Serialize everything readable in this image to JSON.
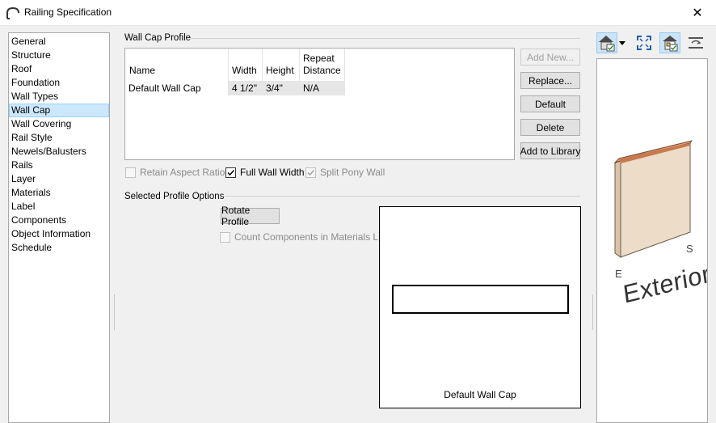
{
  "window": {
    "title": "Railing Specification",
    "close_glyph": "✕"
  },
  "nav": {
    "items": [
      {
        "label": "General"
      },
      {
        "label": "Structure"
      },
      {
        "label": "Roof"
      },
      {
        "label": "Foundation"
      },
      {
        "label": "Wall Types"
      },
      {
        "label": "Wall Cap",
        "selected": true
      },
      {
        "label": "Wall Covering"
      },
      {
        "label": "Rail Style"
      },
      {
        "label": "Newels/Balusters"
      },
      {
        "label": "Rails"
      },
      {
        "label": "Layer"
      },
      {
        "label": "Materials"
      },
      {
        "label": "Label"
      },
      {
        "label": "Components"
      },
      {
        "label": "Object Information"
      },
      {
        "label": "Schedule"
      }
    ]
  },
  "wall_cap_profile": {
    "section_title": "Wall Cap Profile",
    "columns": {
      "name": "Name",
      "width": "Width",
      "height": "Height",
      "repeat_line1": "Repeat",
      "repeat_line2": "Distance"
    },
    "rows": [
      {
        "name": "Default Wall Cap",
        "width": "4 1/2\"",
        "height": "3/4\"",
        "repeat_distance": "N/A"
      }
    ],
    "buttons": {
      "add_new": "Add New...",
      "replace": "Replace...",
      "default": "Default",
      "delete": "Delete",
      "add_to_library": "Add to Library"
    }
  },
  "options": {
    "retain_aspect_ratio": {
      "label": "Retain Aspect Ratio",
      "checked": false,
      "enabled": false
    },
    "full_wall_width": {
      "label": "Full Wall Width",
      "checked": true,
      "enabled": true
    },
    "split_pony_wall": {
      "label": "Split Pony Wall",
      "checked": true,
      "enabled": false
    }
  },
  "selected_profile_options": {
    "section_title": "Selected Profile Options",
    "rotate_profile_label": "Rotate Profile",
    "count_components": {
      "label": "Count Components in Materials List",
      "checked": false,
      "enabled": false
    },
    "preview_caption": "Default Wall Cap"
  },
  "view_toolbar": {
    "icons": [
      "camera-type-icon",
      "dropdown-arrow-icon",
      "fill-window-icon",
      "show-surroundings-icon",
      "pan-rotate-icon"
    ]
  },
  "preview_3d": {
    "compass_s": "S",
    "compass_e": "E",
    "exterior_label": "Exterior",
    "colors": {
      "cap": "#e39a6e",
      "wall_face": "#ecdcc8",
      "wall_side": "#d9c3a6"
    }
  },
  "colors": {
    "selection_bg": "#cce8ff",
    "selection_border": "#99d1ff",
    "toolbar_pressed": "#cce4f7"
  }
}
